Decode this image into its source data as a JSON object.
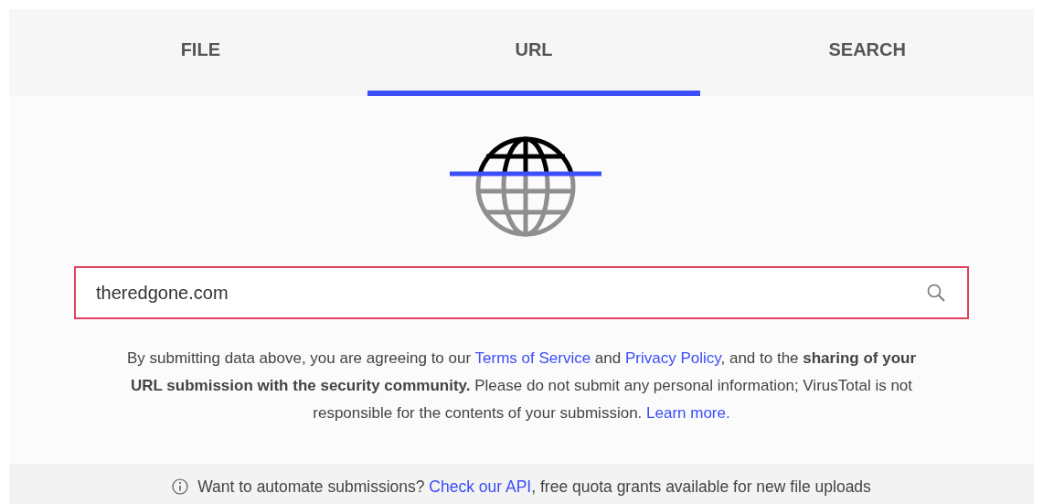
{
  "tabs": [
    {
      "label": "FILE",
      "selected": false
    },
    {
      "label": "URL",
      "selected": true
    },
    {
      "label": "SEARCH",
      "selected": false
    }
  ],
  "url_field": {
    "value": "theredgone.com"
  },
  "notice": [
    {
      "kind": "text",
      "text": "By submitting data above, you are agreeing to our "
    },
    {
      "kind": "link",
      "text": "Terms of Service"
    },
    {
      "kind": "text",
      "text": " and "
    },
    {
      "kind": "link",
      "text": "Privacy Policy"
    },
    {
      "kind": "text",
      "text": ", and to the **sharing of your URL submission with the security community.** Please do not submit any personal information; VirusTotal is not responsible for the contents of your submission. "
    },
    {
      "kind": "link",
      "text": "Learn more."
    }
  ],
  "footer": [
    {
      "kind": "text",
      "text": "Want to automate submissions? "
    },
    {
      "kind": "link",
      "text": "Check our API"
    },
    {
      "kind": "text",
      "text": ", free quota grants available for new file uploads"
    }
  ]
}
